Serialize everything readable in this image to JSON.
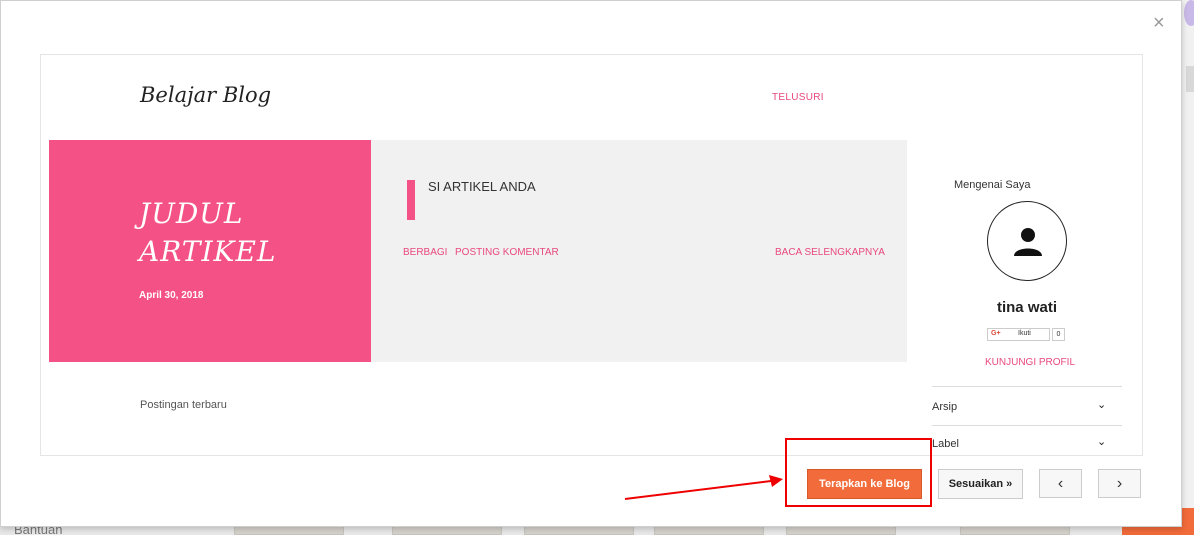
{
  "background": {
    "bantuan_label": "Bantuan"
  },
  "dialog": {
    "close_glyph": "×",
    "close_icon": "close-icon"
  },
  "preview": {
    "blog_title": "Belajar Blog",
    "nav_link": "TELUSURI",
    "post": {
      "title": "JUDUL ARTIKEL",
      "date": "April 30, 2018",
      "snippet": "SI ARTIKEL ANDA",
      "share_label": "BERBAGI",
      "comment_label": "POSTING KOMENTAR",
      "read_more_label": "BACA SELENGKAPNYA"
    },
    "recent_posts_label": "Postingan terbaru",
    "sidebar": {
      "about_heading": "Mengenai Saya",
      "profile_name": "tina wati",
      "gplus_label": "G+",
      "follow_label": "Ikuti",
      "follow_count": "0",
      "visit_profile_label": "KUNJUNGI PROFIL",
      "archive_label": "Arsip",
      "label_label": "Label",
      "chevron_glyph": "⌄"
    },
    "accent_color": "#f45186"
  },
  "footer": {
    "apply_label": "Terapkan ke Blog",
    "customize_label": "Sesuaikan »",
    "prev_glyph": "‹",
    "next_glyph": "›",
    "apply_color": "#f26b3a",
    "highlight_color": "#ee0000"
  }
}
